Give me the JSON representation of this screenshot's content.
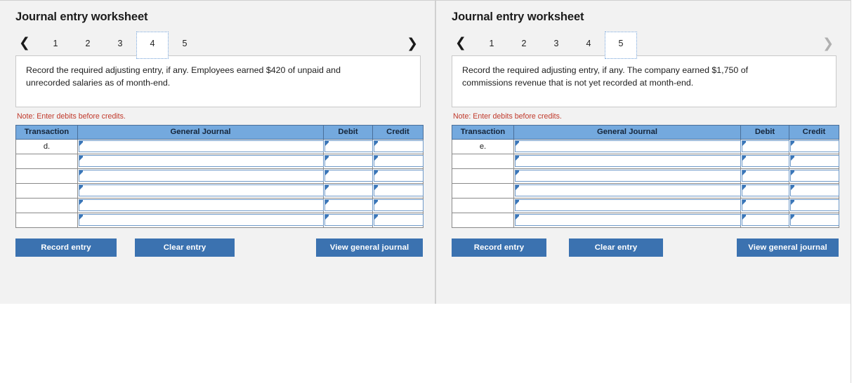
{
  "panels": [
    {
      "title": "Journal entry worksheet",
      "pager": {
        "prev_icon": "chevron-left-icon",
        "next_icon": "chevron-right-icon",
        "prev_disabled": false,
        "next_disabled": false,
        "pages": [
          "1",
          "2",
          "3",
          "4",
          "5"
        ],
        "active_page": "4"
      },
      "prompt": "Record the required adjusting entry, if any. Employees earned $420 of unpaid and unrecorded salaries as of month-end.",
      "note": "Note: Enter debits before credits.",
      "table": {
        "headers": [
          "Transaction",
          "General Journal",
          "Debit",
          "Credit"
        ],
        "rows": [
          {
            "transaction": "d.",
            "general_journal": "",
            "debit": "",
            "credit": ""
          },
          {
            "transaction": "",
            "general_journal": "",
            "debit": "",
            "credit": ""
          },
          {
            "transaction": "",
            "general_journal": "",
            "debit": "",
            "credit": ""
          },
          {
            "transaction": "",
            "general_journal": "",
            "debit": "",
            "credit": ""
          },
          {
            "transaction": "",
            "general_journal": "",
            "debit": "",
            "credit": ""
          },
          {
            "transaction": "",
            "general_journal": "",
            "debit": "",
            "credit": ""
          }
        ]
      },
      "buttons": {
        "record": "Record entry",
        "clear": "Clear entry",
        "view": "View general journal"
      }
    },
    {
      "title": "Journal entry worksheet",
      "pager": {
        "prev_icon": "chevron-left-icon",
        "next_icon": "chevron-right-icon",
        "prev_disabled": false,
        "next_disabled": true,
        "pages": [
          "1",
          "2",
          "3",
          "4",
          "5"
        ],
        "active_page": "5"
      },
      "prompt": "Record the required adjusting entry, if any. The company earned $1,750 of commissions revenue that is not yet recorded at month-end.",
      "note": "Note: Enter debits before credits.",
      "table": {
        "headers": [
          "Transaction",
          "General Journal",
          "Debit",
          "Credit"
        ],
        "rows": [
          {
            "transaction": "e.",
            "general_journal": "",
            "debit": "",
            "credit": ""
          },
          {
            "transaction": "",
            "general_journal": "",
            "debit": "",
            "credit": ""
          },
          {
            "transaction": "",
            "general_journal": "",
            "debit": "",
            "credit": ""
          },
          {
            "transaction": "",
            "general_journal": "",
            "debit": "",
            "credit": ""
          },
          {
            "transaction": "",
            "general_journal": "",
            "debit": "",
            "credit": ""
          },
          {
            "transaction": "",
            "general_journal": "",
            "debit": "",
            "credit": ""
          }
        ]
      },
      "buttons": {
        "record": "Record entry",
        "clear": "Clear entry",
        "view": "View general journal"
      }
    }
  ],
  "colors": {
    "panel_bg": "#f2f2f2",
    "header_blue": "#74a9de",
    "button_blue": "#3b72b0",
    "note_red": "#c0392b",
    "input_border_blue": "#6f9ac9",
    "marker_blue": "#3a76b8"
  }
}
